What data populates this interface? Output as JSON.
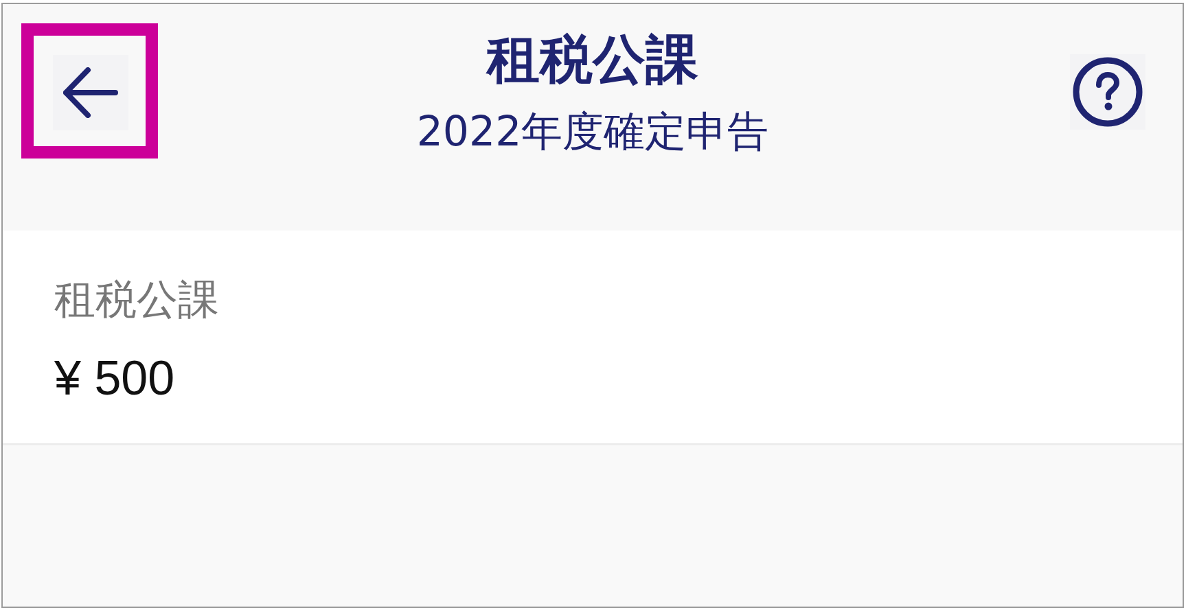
{
  "header": {
    "back_button": {
      "highlighted": true
    },
    "title": "租税公課",
    "subtitle": "2022年度確定申告"
  },
  "fields": [
    {
      "label": "租税公課",
      "value": "¥ 500"
    }
  ]
}
